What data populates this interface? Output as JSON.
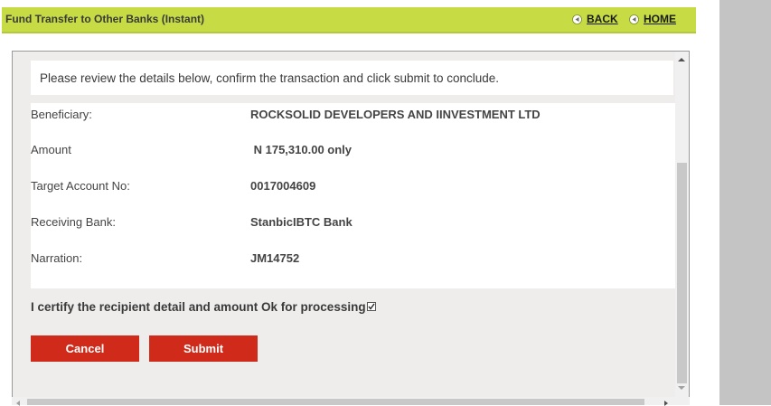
{
  "header": {
    "title": "Fund Transfer to Other Banks (Instant)",
    "back_label": "BACK",
    "home_label": "HOME",
    "arrow_icon": "back-arrow-icon"
  },
  "intro": {
    "text": "Please review the details below, confirm the transaction and click submit to conclude."
  },
  "details": [
    {
      "label": "Beneficiary:",
      "value": "ROCKSOLID DEVELOPERS AND IINVESTMENT LTD"
    },
    {
      "label": "Amount",
      "value": " N 175,310.00 only"
    },
    {
      "label": "Target Account No:",
      "value": "0017004609"
    },
    {
      "label": "Receiving Bank:",
      "value": "StanbicIBTC Bank"
    },
    {
      "label": "Narration:",
      "value": "JM14752"
    }
  ],
  "certify": {
    "text": "I certify the recipient detail and amount Ok for processing",
    "checked": true
  },
  "buttons": {
    "cancel_label": "Cancel",
    "submit_label": "Submit"
  },
  "colors": {
    "header_bg": "#c7dc44",
    "button_bg": "#cf2a1a",
    "panel_bg": "#eeedeb"
  }
}
